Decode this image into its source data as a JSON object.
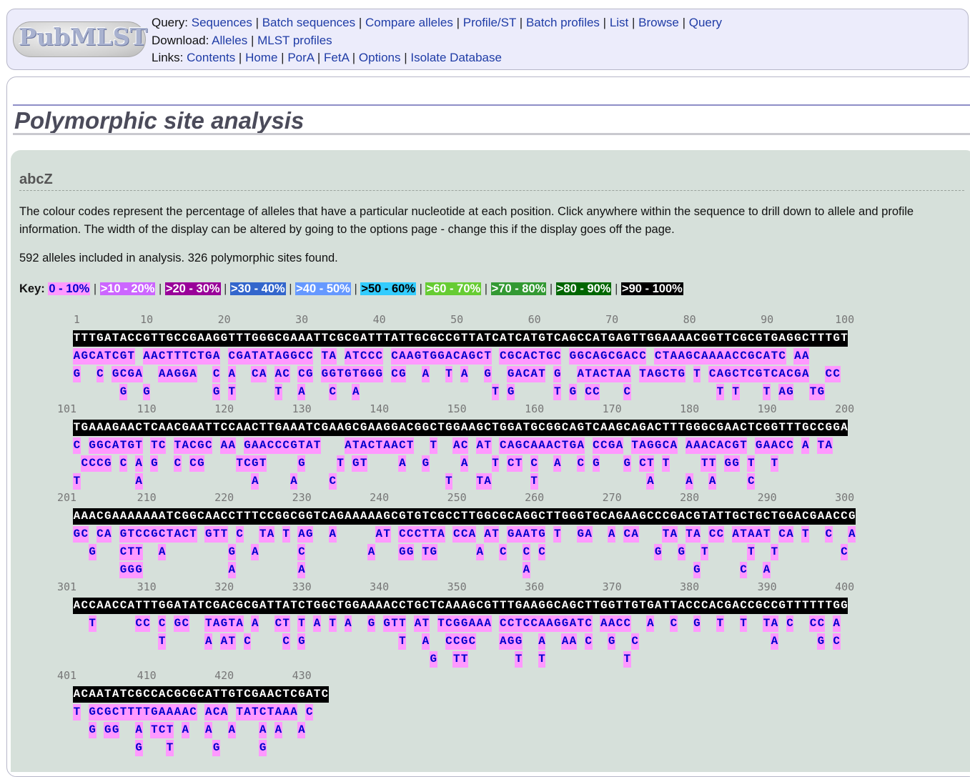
{
  "logo": {
    "text": "PubMLST"
  },
  "nav": {
    "query_label": "Query:",
    "query_links": [
      "Sequences",
      "Batch sequences",
      "Compare alleles",
      "Profile/ST",
      "Batch profiles",
      "List",
      "Browse",
      "Query"
    ],
    "download_label": "Download:",
    "download_links": [
      "Alleles",
      "MLST profiles"
    ],
    "links_label": "Links:",
    "links_links": [
      "Contents",
      "Home",
      "PorA",
      "FetA",
      "Options",
      "Isolate Database"
    ]
  },
  "page_title": "Polymorphic site analysis",
  "locus": "abcZ",
  "description": "The colour codes represent the percentage of alleles that have a particular nucleotide at each position. Click anywhere within the sequence to drill down to allele and profile information. The width of the display can be altered by going to the options page - change this if the display goes off the page.",
  "summary": "592 alleles included in analysis. 326 polymorphic sites found.",
  "key": {
    "label": "Key:",
    "items": [
      {
        "text": "0 - 10%",
        "bg": "#ff99ff",
        "fg": "#0000cc"
      },
      {
        "text": ">10 - 20%",
        "bg": "#cc66ff",
        "fg": "#ffffff"
      },
      {
        "text": ">20 - 30%",
        "bg": "#990099",
        "fg": "#ffffff"
      },
      {
        "text": ">30 - 40%",
        "bg": "#3366cc",
        "fg": "#ffffff"
      },
      {
        "text": ">40 - 50%",
        "bg": "#6699ff",
        "fg": "#ffffff"
      },
      {
        "text": ">50 - 60%",
        "bg": "#33ccff",
        "fg": "#000000"
      },
      {
        "text": ">60 - 70%",
        "bg": "#66cc33",
        "fg": "#ffffff"
      },
      {
        "text": ">70 - 80%",
        "bg": "#339933",
        "fg": "#ffffff"
      },
      {
        "text": ">80 - 90%",
        "bg": "#006600",
        "fg": "#ffffff"
      },
      {
        "text": ">90 - 100%",
        "bg": "#000000",
        "fg": "#ffffff"
      }
    ]
  },
  "colors": {
    "minor": "#ff99ff",
    "minor_text": "#0000cc",
    "consensus_bg": "#000000",
    "consensus_text": "#ffffff",
    "panel_bg": "#d6e0da"
  },
  "sequence_blocks": [
    {
      "ruler": [
        "1",
        "10",
        "20",
        "30",
        "40",
        "50",
        "60",
        "70",
        "80",
        "90",
        "100"
      ],
      "consensus": "TTTGATACCGTTGCCGAAGGTTTGGGCGAAATTCGCGATTTATTGCGCCGTTATCATCATGTCAGCCATGAGTTGGAAAACGGTTCGCGTGAGGCTTTGT",
      "variants": [
        "AGCATCGT AACTTTCTGA CGATATAGGCC TA ATCCC CAAGTGGACAGCT CGCACTGC GGCAGCGACC CTAAGCAAAACCGCATC AA",
        "G  C GCGA  AAGGA  C A  CA AC CG GGTGTGGG CG  A  T A  G  GACAT G  ATACTAA TAGCTG T CAGCTCGTCACGA  CC",
        "      G  G        G T     T  A   C  A                 T G     T G CC   C           T T   T AG  TG"
      ]
    },
    {
      "ruler": [
        "101",
        "110",
        "120",
        "130",
        "140",
        "150",
        "160",
        "170",
        "180",
        "190",
        "200"
      ],
      "consensus": "TGAAAGAACTCAACGAATTCCAACTTGAAATCGAAGCGAAGGACGGCTGGAAGCTGGATGCGGCAGTCAAGCAGACTTTGGGCGAACTCGGTTTGCCGGA",
      "variants": [
        "C GGCATGT TC TACGC AA GAACCCGTAT   ATACTAACT  T  AC AT CAGCAAACTGA CCGA TAGGCA AAACACGT GAACC A TA",
        " CCCG C A G  C CG    TCGT    G    T GT    A  G    A   T CT C  A  C G   G CT T    TT GG T  T",
        "T       A              A    A    C              T   TA     T              A    A  A    C"
      ]
    },
    {
      "ruler": [
        "201",
        "210",
        "220",
        "230",
        "240",
        "250",
        "260",
        "270",
        "280",
        "290",
        "300"
      ],
      "consensus": "AAACGAAAAAAATCGGCAACCTTTCCGGCGGTCAGAAAAAGCGTGTCGCCTTGGCGCAGGCTTGGGTGCAGAAGCCCGACGTATTGCTGCTGGACGAACCG",
      "variants": [
        "GC CA GTCCGCTACT GTT C  TA T AG  A     AT CCCTTA CCA AT GAATG T  GA  A CA   TA TA CC ATAAT CA T  C  A",
        "  G   CTT  A        G  A     C        A   GG TG     A  C  C C              G  G  T     T  T        C",
        "      GGG           A        A                            A                     G     C  A"
      ]
    },
    {
      "ruler": [
        "301",
        "310",
        "320",
        "330",
        "340",
        "350",
        "360",
        "370",
        "380",
        "390",
        "400"
      ],
      "consensus": "ACCAACCATTTGGATATCGACGCGATTATCTGGCTGGAAAACCTGCTCAAAGCGTTTGAAGGCAGCTTGGTTGTGATTACCCACGACCGCCGTTTTTTGG",
      "variants": [
        "  T     CC C GC  TAGTA A  CT T A T A  G GTT AT TCGGAAA CCTCCAAGGATC AACC  A  C  G  T  T  TA C  CC A",
        "           T     A AT C    C G            T  A  CCGC   AGG  A  AA C  G  C                 A     G C",
        "                                              G  TT      T  T          T"
      ]
    },
    {
      "ruler": [
        "401",
        "410",
        "420",
        "430"
      ],
      "consensus": "ACAATATCGCCACGCGCATTGTCGAACTCGATC",
      "variants": [
        "T GCGCTTTTGAAAAC ACA TATCTAAA C",
        "  G GG  A TCT A  A  A   A A  A",
        "        G   T     G     G"
      ]
    }
  ]
}
